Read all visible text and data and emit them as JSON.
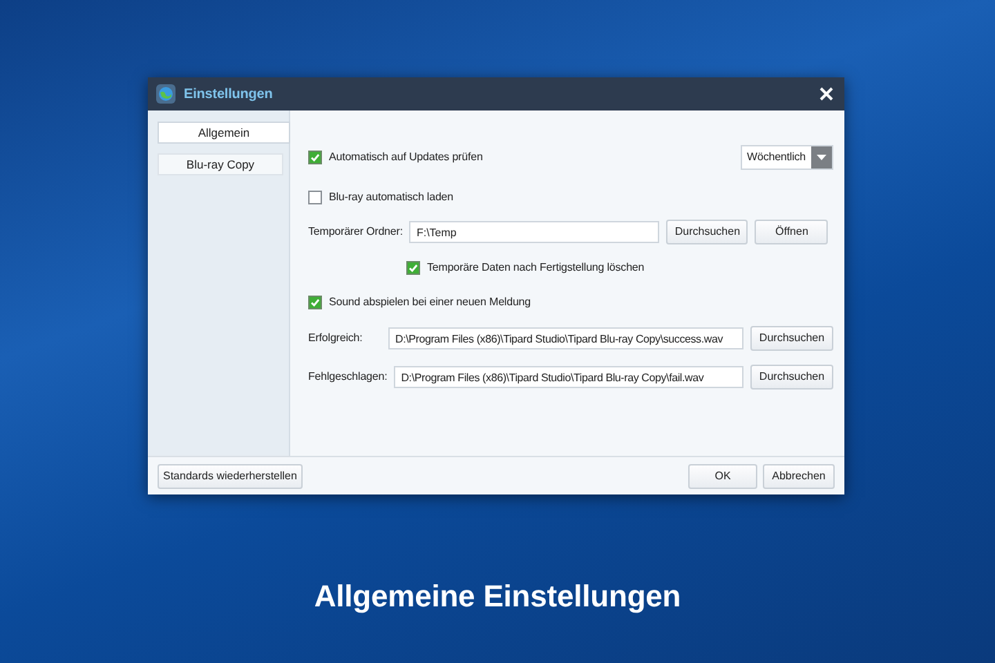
{
  "window": {
    "title": "Einstellungen"
  },
  "sidebar": {
    "items": [
      {
        "label": "Allgemein",
        "selected": true
      },
      {
        "label": "Blu-ray Copy",
        "selected": false
      }
    ]
  },
  "update_check": {
    "label": "Automatisch auf Updates prüfen",
    "checked": true,
    "dropdown": {
      "value": "Wöchentlich"
    }
  },
  "autoload": {
    "label": "Blu-ray automatisch laden",
    "checked": false
  },
  "temp_folder": {
    "label": "Temporärer Ordner:",
    "value": "F:\\Temp",
    "buttons": [
      "Durchsuchen",
      "Öffnen"
    ]
  },
  "delete_temp": {
    "label": "Temporäre Daten nach Fertigstellung löschen",
    "checked": true
  },
  "sound": {
    "label": "Sound abspielen bei einer neuen Meldung",
    "checked": true
  },
  "sound_files": [
    {
      "label": "Erfolgreich:",
      "value": "D:\\Program Files (x86)\\Tipard Studio\\Tipard Blu-ray Copy\\success.wav",
      "button": "Durchsuchen"
    },
    {
      "label": "Fehlgeschlagen:",
      "value": "D:\\Program Files (x86)\\Tipard Studio\\Tipard Blu-ray Copy\\fail.wav",
      "button": "Durchsuchen"
    }
  ],
  "footer": {
    "reset_button": "Standards wiederherstellen",
    "buttons": [
      "OK",
      "Abbrechen"
    ]
  },
  "caption": "Allgemeine Einstellungen"
}
